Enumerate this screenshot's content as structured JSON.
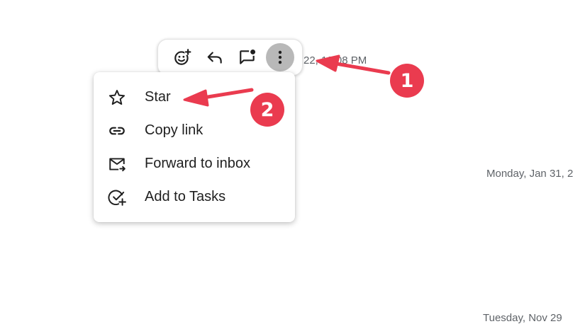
{
  "message": {
    "timestamp": "22, 12:08 PM"
  },
  "date_separators": [
    "Monday, Jan 31, 2",
    "Tuesday, Nov 29"
  ],
  "action_bar": {
    "buttons": [
      {
        "icon": "add-reaction-icon"
      },
      {
        "icon": "reply-icon"
      },
      {
        "icon": "reply-in-thread-icon"
      },
      {
        "icon": "more-vert-icon"
      }
    ]
  },
  "menu": {
    "items": [
      {
        "label": "Star",
        "icon": "star-icon"
      },
      {
        "label": "Copy link",
        "icon": "link-icon"
      },
      {
        "label": "Forward to inbox",
        "icon": "forward-to-inbox-icon"
      },
      {
        "label": "Add to Tasks",
        "icon": "add-task-icon"
      }
    ]
  },
  "annotations": {
    "step1": "1",
    "step2": "2",
    "color": "#ea3b4f"
  }
}
